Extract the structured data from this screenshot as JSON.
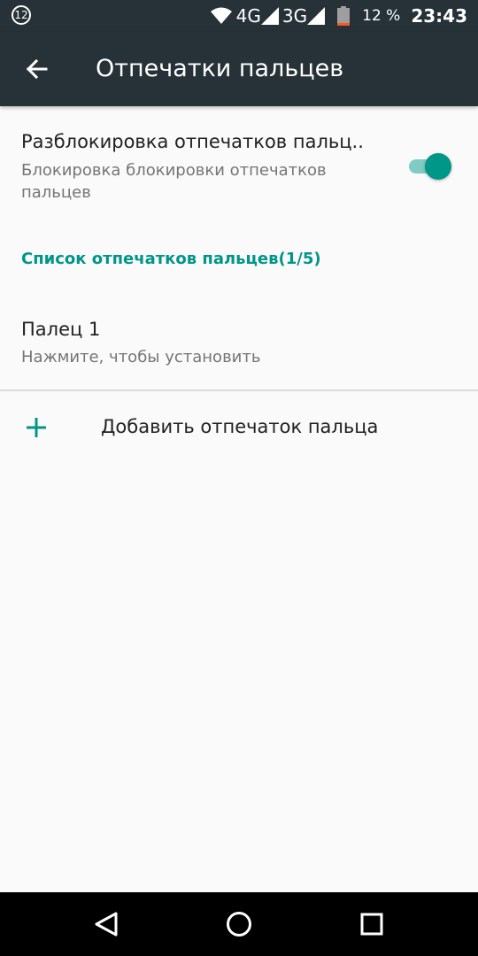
{
  "status_bar": {
    "notification_count": "12",
    "network_4g": "4G",
    "network_3g": "3G",
    "battery_percent": "12 %",
    "time": "23:43",
    "icons": [
      "wifi-icon",
      "signal-icon",
      "battery-icon"
    ]
  },
  "app_bar": {
    "title": "Отпечатки пальцев",
    "back_icon": "arrow-back-icon"
  },
  "fingerprint_unlock": {
    "title": "Разблокировка отпечатков пальц..",
    "summary": "Блокировка блокировки отпечатков пальцев",
    "enabled": true
  },
  "list_header": "Список отпечатков пальцев(1/5)",
  "fingers": [
    {
      "title": "Палец 1",
      "summary": "Нажмите, чтобы установить"
    }
  ],
  "add_fingerprint": {
    "label": "Добавить отпечаток пальца",
    "icon": "plus-icon"
  },
  "nav_bar": {
    "icons": [
      "back-icon",
      "home-icon",
      "recents-icon"
    ]
  },
  "colors": {
    "toolbar": "#263238",
    "accent": "#009688",
    "switch_track": "#80cbc4",
    "background": "#fafafa"
  }
}
